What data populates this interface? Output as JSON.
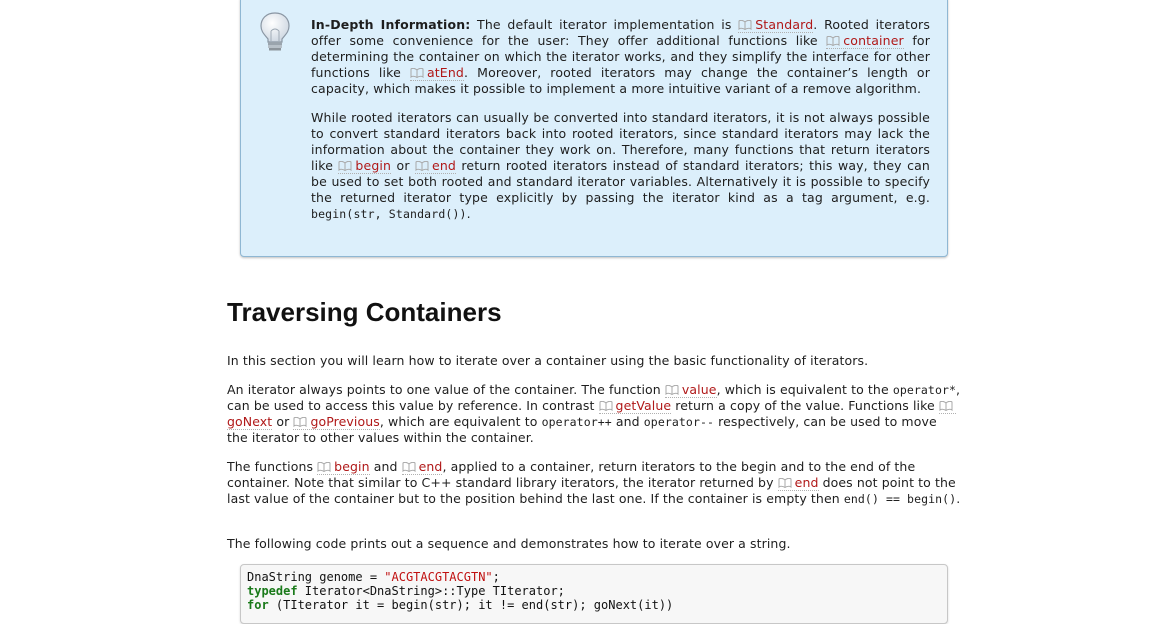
{
  "info": {
    "label": "In-Depth Information:",
    "p1": {
      "t1": " The default iterator implementation is ",
      "l1": "Standard",
      "t2": ". Rooted iterators offer some convenience for the user: They offer additional functions like ",
      "l2": "container",
      "t3": " for determining the container on which the iterator works, and they simplify the interface for other functions like ",
      "l3": "atEnd",
      "t4": ". Moreover, rooted iterators may change the container’s length or capacity, which makes it possible to implement a more intuitive variant of a remove algorithm."
    },
    "p2": {
      "t1": "While rooted iterators can usually be converted into standard iterators, it is not always possible to convert standard iterators back into rooted iterators, since standard iterators may lack the information about the container they work on. Therefore, many functions that return iterators like ",
      "l1": "begin",
      "t2": " or ",
      "l2": "end",
      "t3": " return rooted iterators instead of standard iterators; this way, they can be used to set both rooted and standard iterator variables. Alternatively it is possible to specify the returned iterator type explicitly by passing the iterator kind as a tag argument, e.g. ",
      "c1": "begin(str, Standard())",
      "t4": "."
    }
  },
  "section": {
    "title": "Traversing Containers",
    "p1": "In this section you will learn how to iterate over a container using the basic functionality of iterators.",
    "p2": {
      "t1": "An iterator always points to one value of the container. The function ",
      "l1": "value",
      "t2": ", which is equivalent to the ",
      "c1": "operator*",
      "t3": ", can be used to access this value by reference. In contrast ",
      "l2": "getValue",
      "t4": " return a copy of the value. Functions like ",
      "l3": "goNext",
      "t5": " or ",
      "l4": "goPrevious",
      "t6": ", which are equivalent to ",
      "c2": "operator++",
      "t7": " and ",
      "c3": "operator--",
      "t8": " respectively, can be used to move the iterator to other values within the container."
    },
    "p3": {
      "t1": "The functions ",
      "l1": "begin",
      "t2": " and ",
      "l2": "end",
      "t3": ", applied to a container, return iterators to the begin and to the end of the container. Note that similar to C++ standard library iterators, the iterator returned by ",
      "l3": "end",
      "t4": " does not point to the last value of the container but to the position behind the last one. If the container is empty then ",
      "c1": "end() == begin()",
      "t5": "."
    },
    "p4": "The following code prints out a sequence and demonstrates how to iterate over a string."
  },
  "code": {
    "l1a": "DnaString genome = ",
    "l1s": "\"ACGTACGTACGTN\"",
    "l1b": ";",
    "l2k": "typedef",
    "l2": " Iterator<DnaString>::Type TIterator;",
    "l3k": "for",
    "l3": " (TIterator it = begin(str); it != end(str); goNext(it))"
  },
  "colors": {
    "link": "#b01818",
    "infobox_bg": "#dceffb",
    "keyword": "#1a7a1a",
    "string": "#c01010"
  },
  "icons": {
    "info": "lightbulb-icon",
    "ref": "book-icon"
  }
}
